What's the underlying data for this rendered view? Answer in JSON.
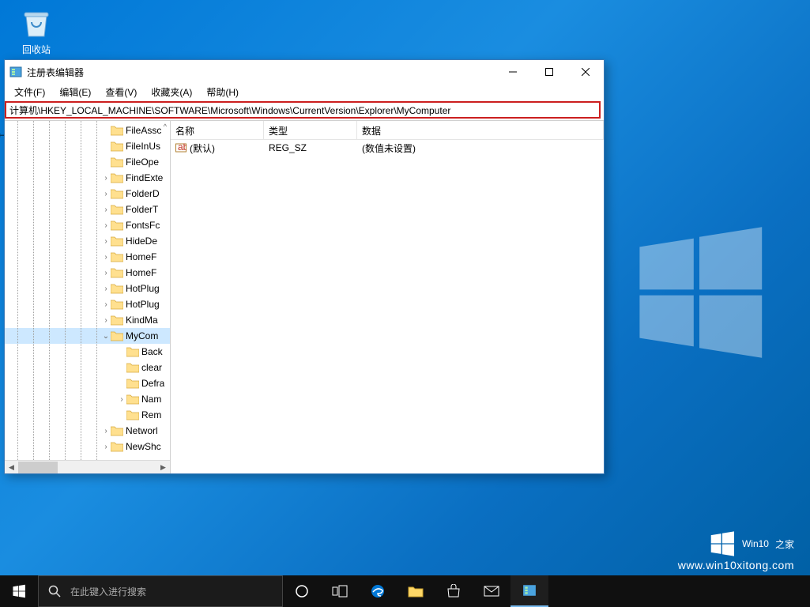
{
  "desktop": {
    "recycle_label": "回收站"
  },
  "window": {
    "title": "注册表编辑器",
    "menu": {
      "file": "文件(F)",
      "edit": "编辑(E)",
      "view": "查看(V)",
      "favorites": "收藏夹(A)",
      "help": "帮助(H)"
    },
    "address": "计算机\\HKEY_LOCAL_MACHINE\\SOFTWARE\\Microsoft\\Windows\\CurrentVersion\\Explorer\\MyComputer"
  },
  "tree": {
    "scroll_hint": "^",
    "items": [
      {
        "indent": 122,
        "expander": "",
        "label": "FileAssc"
      },
      {
        "indent": 122,
        "expander": "",
        "label": "FileInUs"
      },
      {
        "indent": 122,
        "expander": "",
        "label": "FileOpe"
      },
      {
        "indent": 122,
        "expander": ">",
        "label": "FindExte"
      },
      {
        "indent": 122,
        "expander": ">",
        "label": "FolderD"
      },
      {
        "indent": 122,
        "expander": ">",
        "label": "FolderT"
      },
      {
        "indent": 122,
        "expander": ">",
        "label": "FontsFc"
      },
      {
        "indent": 122,
        "expander": ">",
        "label": "HideDe"
      },
      {
        "indent": 122,
        "expander": ">",
        "label": "HomeF"
      },
      {
        "indent": 122,
        "expander": ">",
        "label": "HomeF"
      },
      {
        "indent": 122,
        "expander": ">",
        "label": "HotPlug"
      },
      {
        "indent": 122,
        "expander": ">",
        "label": "HotPlug"
      },
      {
        "indent": 122,
        "expander": ">",
        "label": "KindMa"
      },
      {
        "indent": 122,
        "expander": "v",
        "label": "MyCom",
        "selected": true
      },
      {
        "indent": 142,
        "expander": "",
        "label": "Back"
      },
      {
        "indent": 142,
        "expander": "",
        "label": "clear"
      },
      {
        "indent": 142,
        "expander": "",
        "label": "Defra"
      },
      {
        "indent": 142,
        "expander": ">",
        "label": "Nam"
      },
      {
        "indent": 142,
        "expander": "",
        "label": "Rem"
      },
      {
        "indent": 122,
        "expander": ">",
        "label": "Networl"
      },
      {
        "indent": 122,
        "expander": ">",
        "label": "NewShc"
      }
    ]
  },
  "details": {
    "headers": {
      "name": "名称",
      "type": "类型",
      "data": "数据"
    },
    "rows": [
      {
        "name": "(默认)",
        "type": "REG_SZ",
        "data": "(数值未设置)"
      }
    ]
  },
  "taskbar": {
    "search_placeholder": "在此键入进行搜索"
  },
  "watermark": {
    "brand_en": "Win10",
    "brand_cn": "之家",
    "url": "www.win10xitong.com"
  }
}
